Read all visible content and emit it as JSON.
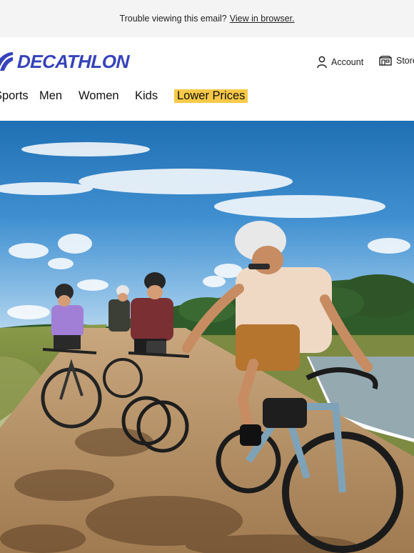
{
  "preheader": {
    "text": "Trouble viewing this email?",
    "link_label": "View in browser."
  },
  "brand": {
    "name": "DECATHLON",
    "color": "#3643ba"
  },
  "header": {
    "account_label": "Account",
    "stores_label": "Stores"
  },
  "nav": {
    "items": [
      {
        "label": "Sports"
      },
      {
        "label": "Men"
      },
      {
        "label": "Women"
      },
      {
        "label": "Kids"
      },
      {
        "label": "Lower Prices"
      }
    ],
    "highlight_color": "#f7c948"
  },
  "hero": {
    "image": "group of cyclists riding gravel bikes on a dirt path under a blue sky"
  }
}
